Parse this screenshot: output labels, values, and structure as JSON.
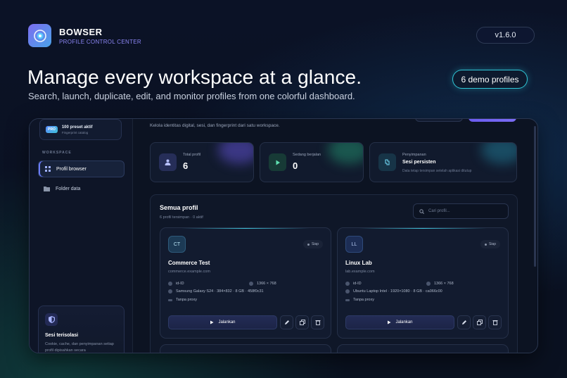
{
  "brand": {
    "name": "BOWSER",
    "subtitle": "PROFILE CONTROL CENTER",
    "version": "v1.6.0"
  },
  "hero": {
    "headline": "Manage every workspace at a glance.",
    "subline": "Search, launch, duplicate, edit, and monitor profiles from one colorful dashboard.",
    "badge": "6 demo profiles"
  },
  "sidebar": {
    "preset_badge": "PRO",
    "preset_title": "100 preset aktif",
    "preset_sub": "Fingerprint catalog",
    "section_label": "WORKSPACE",
    "items": [
      {
        "label": "Profil browser",
        "icon": "grid-icon",
        "active": true
      },
      {
        "label": "Folder data",
        "icon": "folder-icon",
        "active": false
      }
    ],
    "isolated_card": {
      "title": "Sesi terisolasi",
      "desc": "Cookie, cache, dan penyimpanan setiap profil dipisahkan secara"
    }
  },
  "main": {
    "description": "Kelola identitas digital, sesi, dan fingerprint dari satu workspace.",
    "stats": [
      {
        "label": "Total profil",
        "value": "6",
        "sub": "",
        "icon": "user-icon"
      },
      {
        "label": "Sedang berjalan",
        "value": "0",
        "sub": "",
        "icon": "play-icon"
      },
      {
        "label": "Penyimpanan",
        "value": "Sesi persisten",
        "sub": "Data tetap tersimpan setelah aplikasi ditutup",
        "icon": "storage-icon"
      }
    ],
    "profiles_panel": {
      "title": "Semua profil",
      "subtitle": "6 profil tersimpan · 0 aktif",
      "search_placeholder": "Cari profil..."
    },
    "profiles": [
      {
        "initials": "CT",
        "status": "Siap",
        "name": "Commerce Test",
        "domain": "commerce.example.com",
        "locale": "id-ID",
        "resolution": "1366 × 768",
        "device": "Samsung Galaxy S24 · 384×832 · 8 GB · 458f0c31",
        "proxy": "Tanpa proxy",
        "run_label": "Jalankan"
      },
      {
        "initials": "LL",
        "status": "Siap",
        "name": "Linux Lab",
        "domain": "lab.example.com",
        "locale": "id-ID",
        "resolution": "1366 × 768",
        "device": "Ubuntu Laptop Intel · 1920×1080 · 8 GB · ca066c00",
        "proxy": "Tanpa proxy",
        "run_label": "Jalankan"
      }
    ]
  }
}
